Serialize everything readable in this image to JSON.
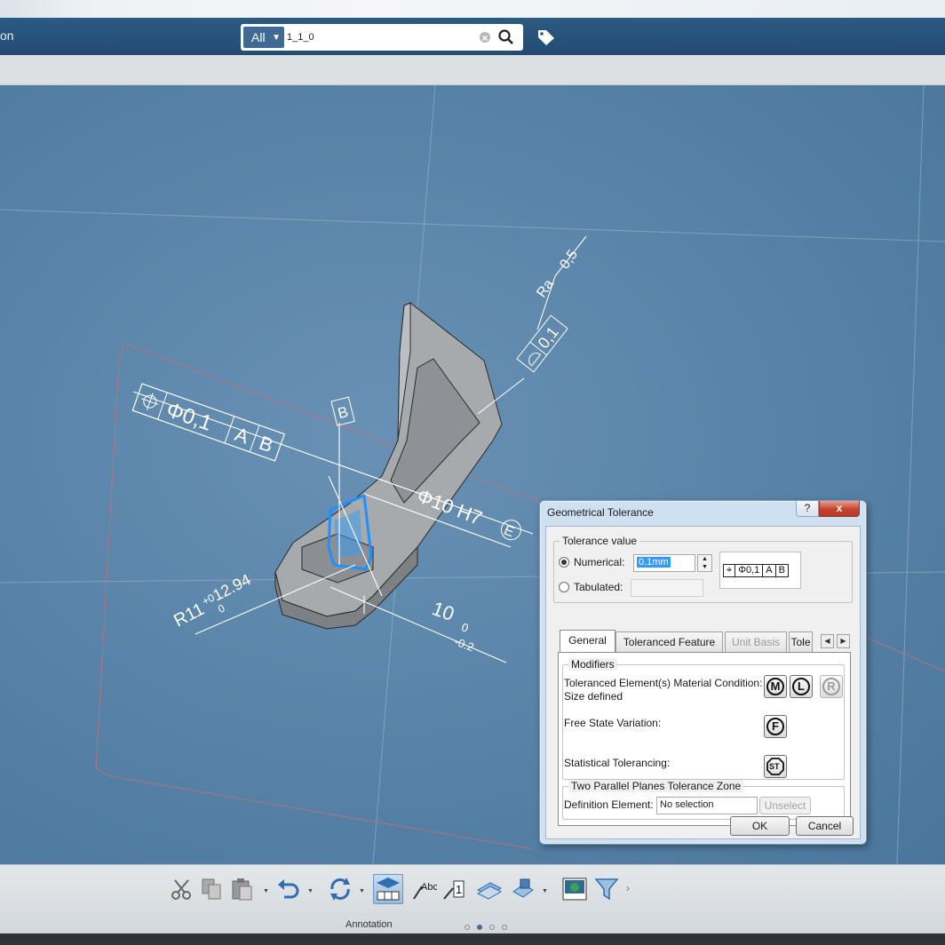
{
  "header": {
    "app_title": "on",
    "search": {
      "scope": "All",
      "query": "1_1_0"
    }
  },
  "drawing": {
    "fcf_main": [
      "Φ0,1",
      "A",
      "B"
    ],
    "datum_b": "B",
    "hole_dim": "Φ10 H7",
    "envelope": "E",
    "radius_dim": "R11",
    "radius_tol_upper": "+0",
    "radius_tol_lower": "0",
    "radius_tol": "12.94",
    "length_dim": "10",
    "length_tol_upper": "0",
    "length_tol_lower": "-0.2",
    "flatness_value": "0,1",
    "roughness_symbol": "Ra",
    "roughness_value": "0,5"
  },
  "dialog": {
    "title": "Geometrical Tolerance",
    "help": "?",
    "close": "x",
    "tolerance_group": "Tolerance value",
    "numerical_label": "Numerical:",
    "numerical_value": "0.1mm",
    "tabulated_label": "Tabulated:",
    "tabulated_value": "",
    "preview": [
      "Φ0,1",
      "A",
      "B"
    ],
    "tabs": [
      "General",
      "Toleranced Feature",
      "Unit Basis",
      "Tole"
    ],
    "modifiers_group": "Modifiers",
    "material_condition_label": "Toleranced Element(s) Material Condition:",
    "size_defined_label": "Size defined",
    "material_symbols": [
      "M",
      "L",
      "R"
    ],
    "free_state_label": "Free State Variation:",
    "free_state_symbol": "F",
    "statistical_label": "Statistical Tolerancing:",
    "statistical_symbol": "ST",
    "zone_group": "Two Parallel Planes Tolerance Zone",
    "definition_label": "Definition Element:",
    "definition_value": "No selection",
    "unselect_label": "Unselect",
    "ok_label": "OK",
    "cancel_label": "Cancel"
  },
  "toolbar": {
    "section": "Annotation",
    "icons": [
      "cut-icon",
      "copy-icon",
      "paste-icon",
      "undo-icon",
      "update-icon",
      "annotation-set-icon",
      "text-icon",
      "balloon-icon",
      "view-plane-icon",
      "view-3d-icon",
      "capture-icon",
      "filter-icon"
    ],
    "page_count": 4,
    "current_page": 2
  },
  "colors": {
    "titlebar": "#234c72",
    "viewport": "#5a84a9",
    "selection_highlight": "#1e90ff",
    "close_button": "#c5432f"
  }
}
